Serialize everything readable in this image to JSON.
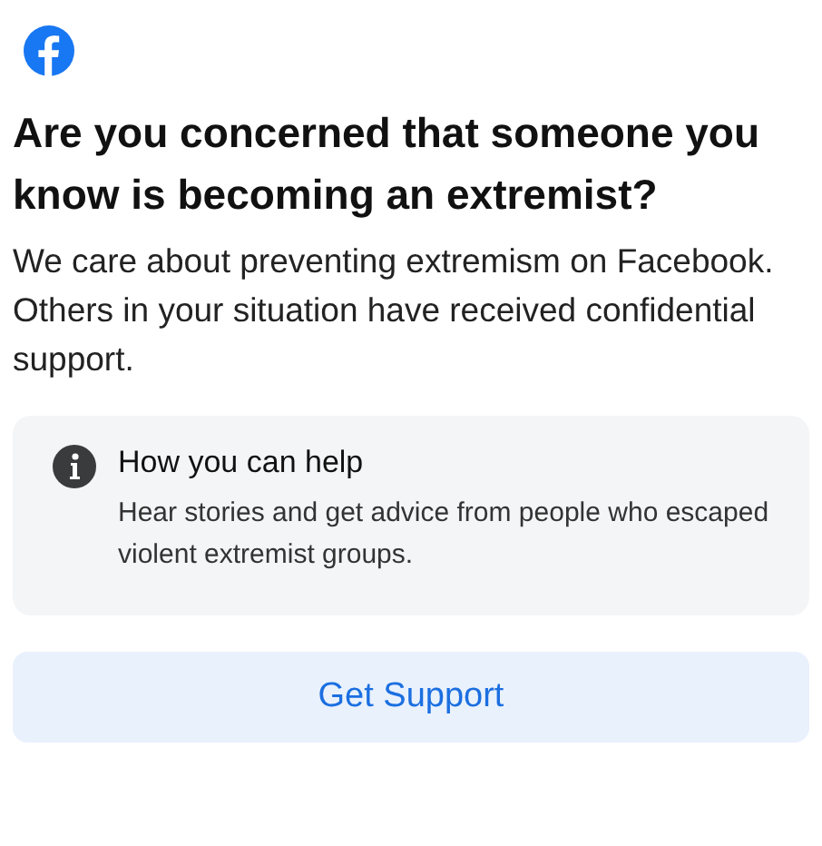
{
  "title": "Are you concerned that someone you know is becoming an extremist?",
  "body": "We care about preventing extremism on Facebook. Others in your situation have received confidential support.",
  "info_card": {
    "heading": "How you can help",
    "text": "Hear stories and get advice from people who escaped violent extremist groups."
  },
  "button": "Get Support"
}
